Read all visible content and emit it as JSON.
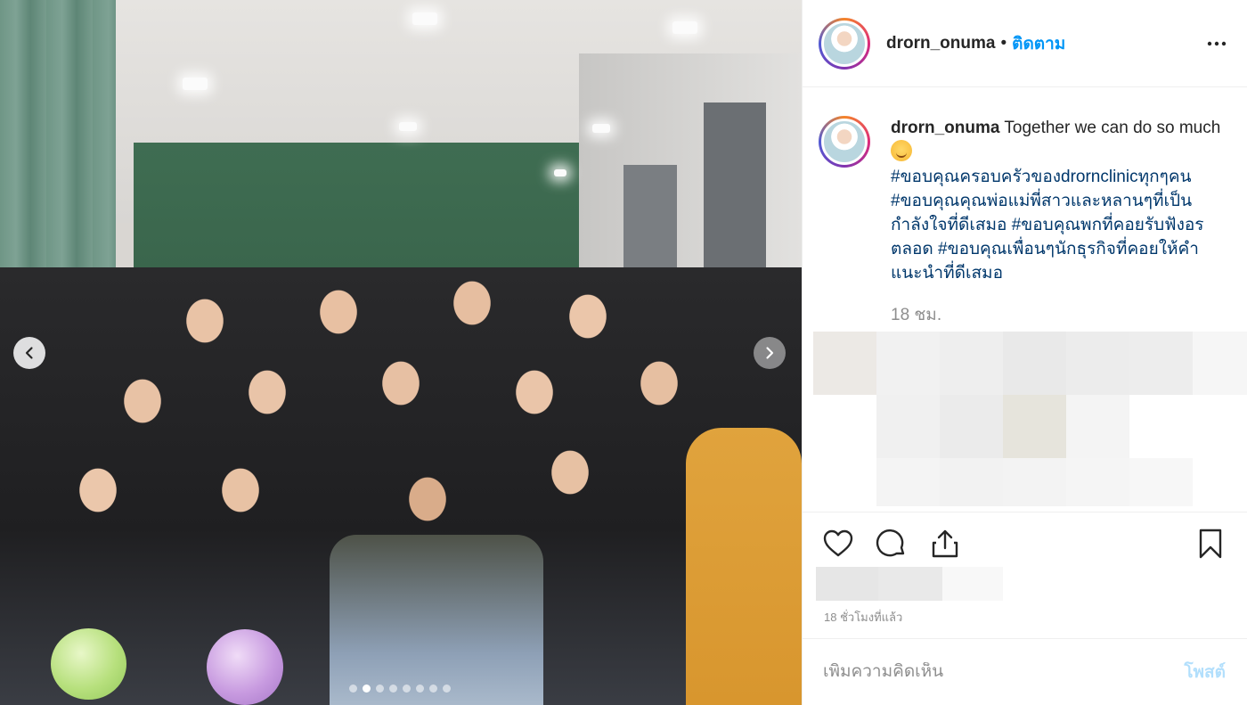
{
  "post": {
    "username": "drorn_onuma",
    "separator": "•",
    "follow_label": "ติดตาม",
    "caption_main": "Together we can do so much",
    "hashtags": [
      "#ขอบคุณครอบครัวของdrornclinicทุกๆคน",
      "#ขอบคุณคุณพ่อแม่พี่สาวและหลานๆที่เป็นกำลังใจที่ดีเสมอ",
      "#ขอบคุณพกที่คอยรับฟังอรตลอด",
      "#ขอบคุณเพื่อนๆนักธุรกิจที่คอยให้คำแนะนำที่ดีเสมอ"
    ],
    "caption_time": "18 ชม.",
    "time_ago": "18 ชั่วโมงที่แล้ว"
  },
  "carousel": {
    "total_slides": 8,
    "active_slide": 2
  },
  "comment": {
    "placeholder": "เพิ่มความคิดเห็น",
    "post_label": "โพสต์"
  },
  "icons": {
    "like": "heart-icon",
    "comment": "comment-icon",
    "share": "share-icon",
    "save": "bookmark-icon",
    "more": "more-icon",
    "prev": "chevron-left-icon",
    "next": "chevron-right-icon"
  },
  "colors": {
    "link": "#00376b",
    "follow": "#0095f6",
    "muted": "#8e8e8e",
    "post_disabled": "#b2dffc"
  }
}
